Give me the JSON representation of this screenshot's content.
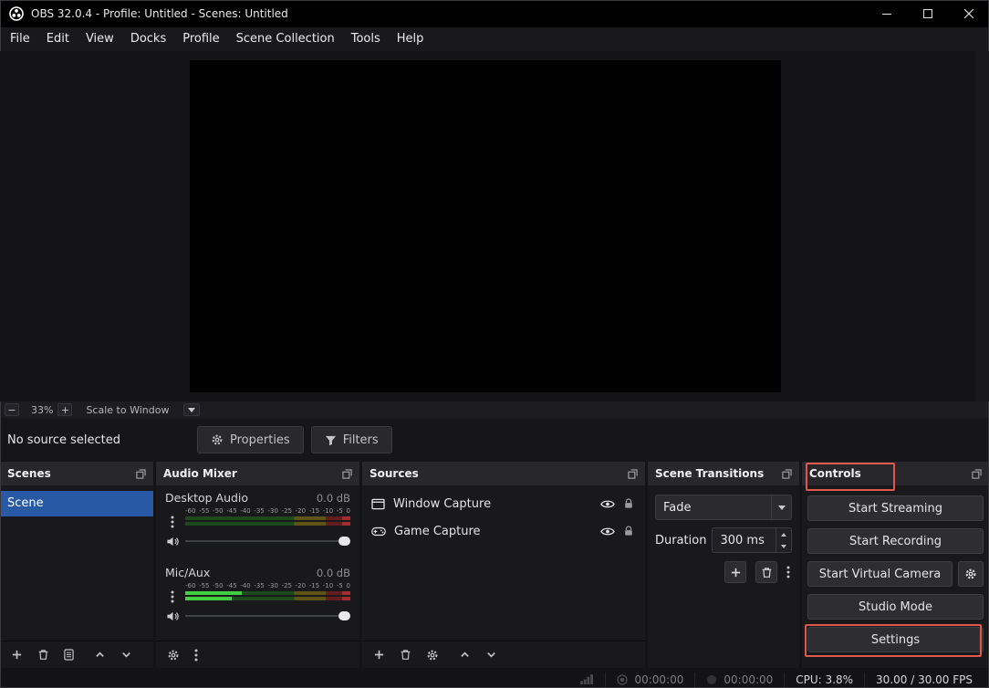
{
  "titlebar": {
    "title": "OBS 32.0.4 - Profile: Untitled - Scenes: Untitled"
  },
  "menu": {
    "items": [
      "File",
      "Edit",
      "View",
      "Docks",
      "Profile",
      "Scene Collection",
      "Tools",
      "Help"
    ]
  },
  "preview_toolbar": {
    "zoom_out": "−",
    "zoom_level": "33%",
    "zoom_in": "+",
    "scale_mode": "Scale to Window"
  },
  "source_toolbar": {
    "status": "No source selected",
    "properties": "Properties",
    "filters": "Filters"
  },
  "scenes_dock": {
    "title": "Scenes",
    "items": [
      {
        "label": "Scene",
        "selected": true
      }
    ]
  },
  "mixer_dock": {
    "title": "Audio Mixer",
    "scale": [
      "-60",
      "-55",
      "-50",
      "-45",
      "-40",
      "-35",
      "-30",
      "-25",
      "-20",
      "-15",
      "-10",
      "-5",
      "0"
    ],
    "mixers": [
      {
        "name": "Desktop Audio",
        "level": "0.0 dB",
        "active_l": "width:0%",
        "active_r": "width:0%"
      },
      {
        "name": "Mic/Aux",
        "level": "0.0 dB",
        "active_l": "width:34%",
        "active_r": "width:28%"
      }
    ]
  },
  "sources_dock": {
    "title": "Sources",
    "items": [
      {
        "label": "Window Capture"
      },
      {
        "label": "Game Capture"
      }
    ]
  },
  "transitions_dock": {
    "title": "Scene Transitions",
    "transition": "Fade",
    "duration_label": "Duration",
    "duration": "300 ms"
  },
  "controls_dock": {
    "title": "Controls",
    "buttons": [
      "Start Streaming",
      "Start Recording",
      "Start Virtual Camera",
      "Studio Mode",
      "Settings"
    ]
  },
  "statusbar": {
    "stream_time": "00:00:00",
    "record_time": "00:00:00",
    "cpu": "CPU: 3.8%",
    "fps": "30.00 / 30.00 FPS"
  },
  "colors": {
    "annotation": "#e0584b",
    "scene_selection": "#2759a5",
    "meter_active": "#41cf41"
  }
}
